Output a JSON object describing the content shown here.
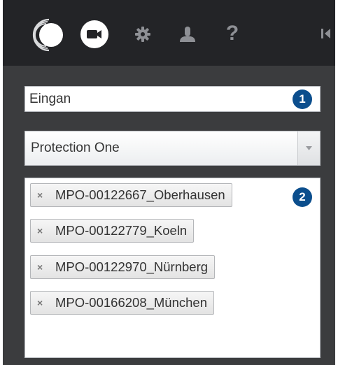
{
  "toolbar": {
    "icons": [
      "logo-icon",
      "camera-icon",
      "gear-icon",
      "user-icon",
      "help-icon",
      "collapse-icon"
    ],
    "help_glyph": "?"
  },
  "search": {
    "value": "Eingan",
    "callout": "1"
  },
  "provider_select": {
    "selected": "Protection One"
  },
  "tags": {
    "callout": "2",
    "items": [
      {
        "remove": "×",
        "label": "MPO-00122667_Oberhausen"
      },
      {
        "remove": "×",
        "label": "MPO-00122779_Koeln"
      },
      {
        "remove": "×",
        "label": "MPO-00122970_Nürnberg"
      },
      {
        "remove": "×",
        "label": "MPO-00166208_München"
      }
    ]
  },
  "colors": {
    "topbar": "#232427",
    "panel": "#3b3c3e",
    "callout": "#0b4e8d"
  }
}
